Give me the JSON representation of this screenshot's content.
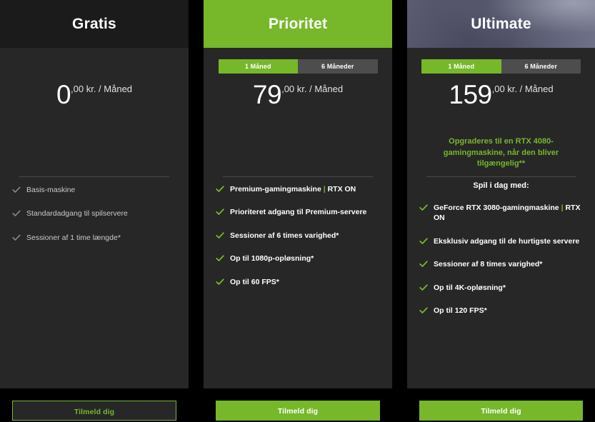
{
  "colors": {
    "accent_green": "#76b82a",
    "column_bg": "#272727",
    "page_bg": "#000000",
    "free_header_bg": "#1b1b1b",
    "toggle_inactive_bg": "#4d4d4d",
    "divider": "#4a4a4a"
  },
  "plans": [
    {
      "id": "gratis",
      "title": "Gratis",
      "has_billing_toggle": false,
      "price": {
        "amount": "0",
        "suffix": ",00 kr. / Måned"
      },
      "features": [
        {
          "text": "Basis-maskine"
        },
        {
          "text": "Standardadgang til spilservere"
        },
        {
          "text": "Sessioner af 1 time længde*"
        }
      ],
      "cta": {
        "label": "Tilmeld dig",
        "style": "outline"
      }
    },
    {
      "id": "prioritet",
      "title": "Prioritet",
      "has_billing_toggle": true,
      "billing": {
        "active": "1 Måned",
        "inactive": "6 Måneder"
      },
      "price": {
        "amount": "79",
        "suffix": ",00 kr. / Måned"
      },
      "features": [
        {
          "text_before": "Premium-gamingmaskine ",
          "separator": "|",
          "text_after": " RTX ON"
        },
        {
          "text": "Prioriteret adgang til Premium-servere"
        },
        {
          "text": "Sessioner af 6 times varighed*"
        },
        {
          "text": "Op til 1080p-opløsning*"
        },
        {
          "text": "Op til 60 FPS*"
        }
      ],
      "cta": {
        "label": "Tilmeld dig",
        "style": "solid"
      }
    },
    {
      "id": "ultimate",
      "title": "Ultimate",
      "has_billing_toggle": true,
      "billing": {
        "active": "1 Måned",
        "inactive": "6 Måneder"
      },
      "price": {
        "amount": "159",
        "suffix": ",00 kr. / Måned"
      },
      "promo": {
        "headline": "Opgraderes til en RTX 4080-gamingmaskine, når den bliver tilgængelig**",
        "subhead": "Spil i dag med:"
      },
      "features": [
        {
          "text_before": "GeForce RTX 3080-gamingmaskine ",
          "separator": "|",
          "text_after": " RTX ON"
        },
        {
          "text": "Eksklusiv adgang til de hurtigste servere"
        },
        {
          "text": "Sessioner af 8 times varighed*"
        },
        {
          "text": "Op til 4K-opløsning*"
        },
        {
          "text": "Op til 120 FPS*"
        }
      ],
      "cta": {
        "label": "Tilmeld dig",
        "style": "solid"
      }
    }
  ]
}
